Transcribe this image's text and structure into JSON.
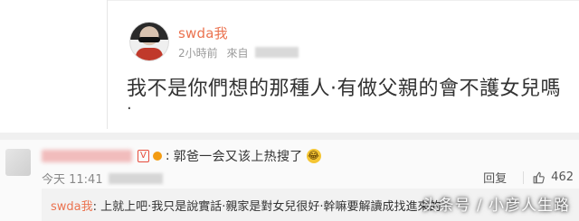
{
  "post": {
    "username": "swda我",
    "time": "2小時前",
    "from_label": "來自",
    "text": "我不是你們想的那種人·有做父親的會不護女兒嗎",
    "dot": "·"
  },
  "comment": {
    "badge": "V",
    "colon": ":",
    "text": "郭爸一会又该上热搜了",
    "emoji": "😂",
    "time": "今天 11:41",
    "reply_label": "回复",
    "like_count": "462"
  },
  "reply": {
    "name": "swda我",
    "colon": ":",
    "text": "上就上吧·我只是說實話·親家是對女兒很好·幹嘛要解讀成找進來的"
  },
  "watermark": "头条号 / 小彦人生路",
  "colors": {
    "username": "#eb7350",
    "badge": "#e74c3c",
    "background": "#ffffff",
    "comment_bg": "#fafafa"
  },
  "icons": {
    "like": "thumbs-up-icon",
    "avatar": "user-avatar"
  }
}
